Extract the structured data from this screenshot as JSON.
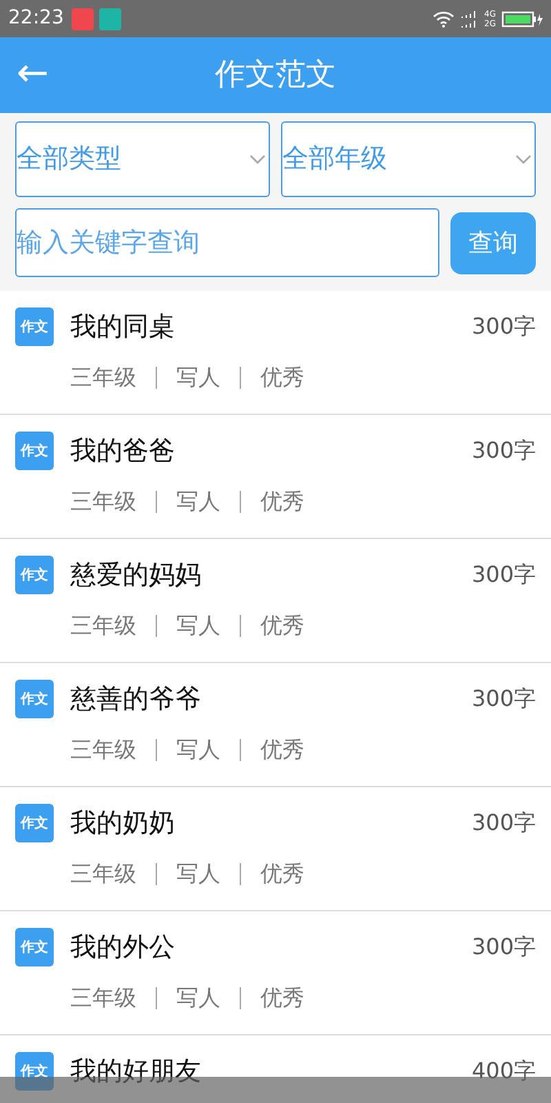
{
  "status_bar": {
    "time": "22:23",
    "network_top": "4G",
    "network_bottom": "2G"
  },
  "header": {
    "back": "←",
    "title": "作文范文"
  },
  "filters": [
    {
      "label": "全部类型"
    },
    {
      "label": "全部年级"
    }
  ],
  "search": {
    "placeholder": "输入关键字查询",
    "button": "查询"
  },
  "essays": [
    {
      "badge": "作文",
      "title": "我的同桌",
      "words": "300字",
      "tags": [
        "三年级",
        "写人",
        "优秀"
      ]
    },
    {
      "badge": "作文",
      "title": "我的爸爸",
      "words": "300字",
      "tags": [
        "三年级",
        "写人",
        "优秀"
      ]
    },
    {
      "badge": "作文",
      "title": "慈爱的妈妈",
      "words": "300字",
      "tags": [
        "三年级",
        "写人",
        "优秀"
      ]
    },
    {
      "badge": "作文",
      "title": "慈善的爷爷",
      "words": "300字",
      "tags": [
        "三年级",
        "写人",
        "优秀"
      ]
    },
    {
      "badge": "作文",
      "title": "我的奶奶",
      "words": "300字",
      "tags": [
        "三年级",
        "写人",
        "优秀"
      ]
    },
    {
      "badge": "作文",
      "title": "我的外公",
      "words": "300字",
      "tags": [
        "三年级",
        "写人",
        "优秀"
      ]
    },
    {
      "badge": "作文",
      "title": "我的好朋友",
      "words": "400字"
    }
  ]
}
